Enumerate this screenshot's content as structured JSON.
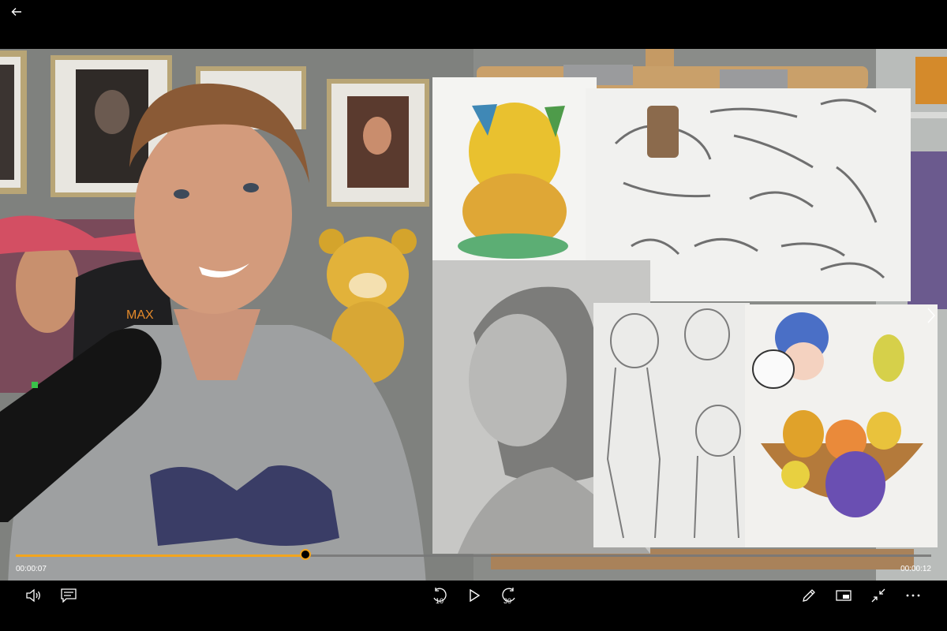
{
  "player": {
    "current_time": "00:00:07",
    "total_time": "00:00:12",
    "progress": 0.316,
    "skip_back_seconds": "10",
    "skip_forward_seconds": "30",
    "accent_color": "#f3a51d"
  },
  "icons": {
    "back": "back-arrow-icon",
    "next": "chevron-right-icon",
    "volume": "volume-icon",
    "captions": "captions-icon",
    "skip_back": "skip-back-10-icon",
    "play": "play-icon",
    "skip_forward": "skip-forward-30-icon",
    "edit": "pen-icon",
    "miniplayer": "miniplayer-icon",
    "exit_fullscreen": "exit-fullscreen-icon",
    "more": "more-options-icon"
  },
  "scene": {
    "chair_brand": "MAX"
  }
}
